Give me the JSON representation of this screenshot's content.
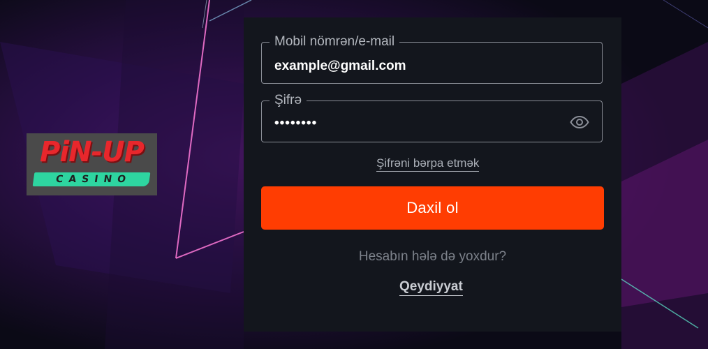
{
  "brand": {
    "logo_main": "PiN-UP",
    "logo_sub": "CASINO"
  },
  "login_form": {
    "login_field": {
      "label": "Mobil nömrən/e-mail",
      "value": "example@gmail.com"
    },
    "password_field": {
      "label": "Şifrə",
      "value": "••••••••",
      "toggle_icon": "eye-icon"
    },
    "forgot_password_link": "Şifrəni bərpa etmək",
    "submit_button": "Daxil ol",
    "no_account_text": "Hesabın hələ də yoxdur?",
    "register_link": "Qeydiyyat"
  },
  "colors": {
    "panel_bg": "#13161d",
    "accent_button": "#ff3d02",
    "logo_red": "#e8272c",
    "logo_teal": "#2ed5a0"
  }
}
